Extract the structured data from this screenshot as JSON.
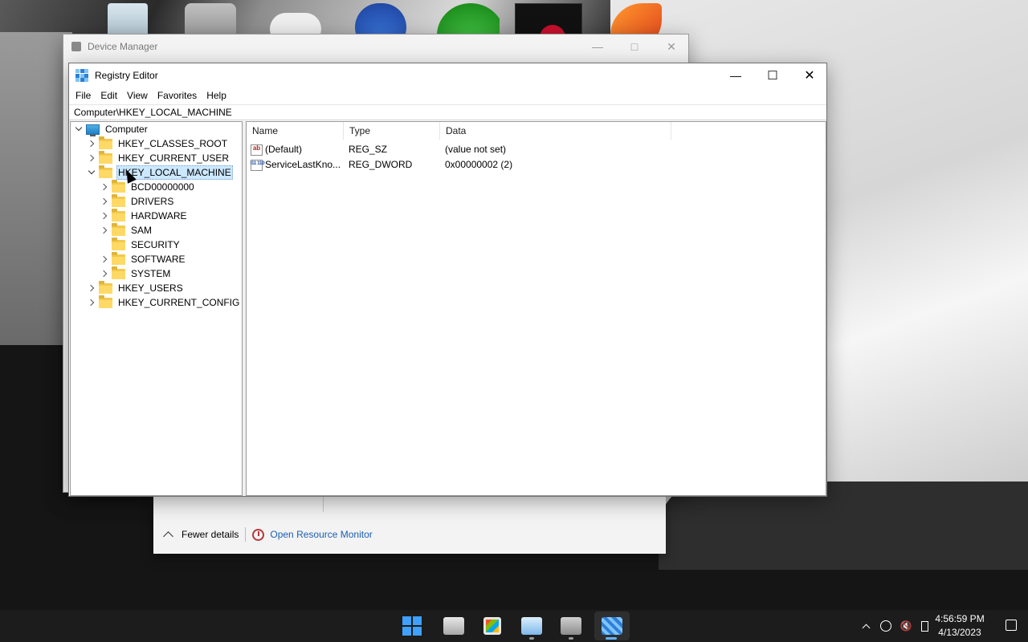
{
  "desktop": {
    "icons": [
      "recycle-bin",
      "folder",
      "controller",
      "app",
      "xbox",
      "app-dark",
      "game-phoenix"
    ]
  },
  "device_manager": {
    "title": "Device Manager"
  },
  "task_manager": {
    "fewer_details": "Fewer details",
    "open_resource_monitor": "Open Resource Monitor"
  },
  "regedit": {
    "title": "Registry Editor",
    "menu": [
      "File",
      "Edit",
      "View",
      "Favorites",
      "Help"
    ],
    "address": "Computer\\HKEY_LOCAL_MACHINE",
    "tree": [
      {
        "label": "Computer",
        "level": 0,
        "expanded": true,
        "icon": "computer-icon"
      },
      {
        "label": "HKEY_CLASSES_ROOT",
        "level": 1,
        "expandable": true
      },
      {
        "label": "HKEY_CURRENT_USER",
        "level": 1,
        "expandable": true
      },
      {
        "label": "HKEY_LOCAL_MACHINE",
        "level": 1,
        "expanded": true,
        "selected": true
      },
      {
        "label": "BCD00000000",
        "level": 2,
        "expandable": true
      },
      {
        "label": "DRIVERS",
        "level": 2,
        "expandable": true
      },
      {
        "label": "HARDWARE",
        "level": 2,
        "expandable": true
      },
      {
        "label": "SAM",
        "level": 2,
        "expandable": true
      },
      {
        "label": "SECURITY",
        "level": 2,
        "expandable": false
      },
      {
        "label": "SOFTWARE",
        "level": 2,
        "expandable": true
      },
      {
        "label": "SYSTEM",
        "level": 2,
        "expandable": true
      },
      {
        "label": "HKEY_USERS",
        "level": 1,
        "expandable": true
      },
      {
        "label": "HKEY_CURRENT_CONFIG",
        "level": 1,
        "expandable": true
      }
    ],
    "columns": [
      "Name",
      "Type",
      "Data"
    ],
    "values": [
      {
        "name": "(Default)",
        "type": "REG_SZ",
        "data": "(value not set)",
        "icon": "string-value-icon",
        "icon_text": "ab"
      },
      {
        "name": "ServiceLastKno...",
        "type": "REG_DWORD",
        "data": "0x00000002 (2)",
        "icon": "binary-value-icon",
        "icon_text": "011 110"
      }
    ]
  },
  "taskbar": {
    "apps": [
      "start",
      "file-explorer",
      "microsoft-store",
      "task-manager",
      "device-manager",
      "registry-editor"
    ],
    "time": "4:56:59 PM",
    "date": "4/13/2023"
  },
  "colors": {
    "selection": "#cce8ff",
    "link": "#1a5fb4",
    "taskbar": "#1c1c1c",
    "accent": "#3fa0ff"
  }
}
